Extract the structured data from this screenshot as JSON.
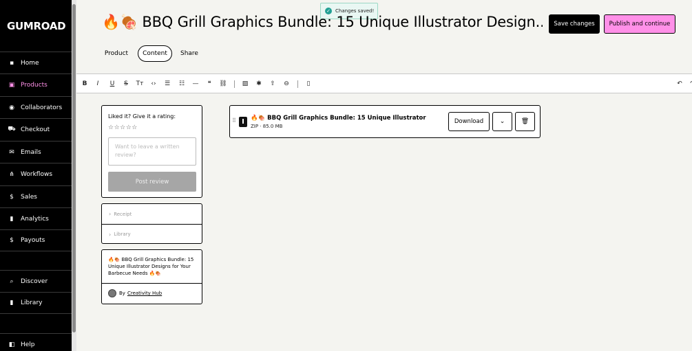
{
  "app": {
    "logo": "GUMROAD"
  },
  "sidebar": {
    "items": [
      {
        "label": "Home",
        "icon": "home-icon",
        "glyph": "▪"
      },
      {
        "label": "Products",
        "icon": "products-icon",
        "glyph": "▣"
      },
      {
        "label": "Collaborators",
        "icon": "collaborators-icon",
        "glyph": "◉"
      },
      {
        "label": "Checkout",
        "icon": "cart-icon",
        "glyph": "⛟"
      },
      {
        "label": "Emails",
        "icon": "mail-icon",
        "glyph": "✉"
      },
      {
        "label": "Workflows",
        "icon": "workflows-icon",
        "glyph": "⋔"
      },
      {
        "label": "Sales",
        "icon": "dollar-icon",
        "glyph": "$"
      },
      {
        "label": "Analytics",
        "icon": "bar-chart-icon",
        "glyph": "▮"
      },
      {
        "label": "Payouts",
        "icon": "bank-icon",
        "glyph": "$"
      },
      {
        "label": "Discover",
        "icon": "search-icon",
        "glyph": "⌕"
      },
      {
        "label": "Library",
        "icon": "bookmark-icon",
        "glyph": "▮"
      },
      {
        "label": "Help",
        "icon": "help-icon",
        "glyph": "◧"
      }
    ],
    "active_index": 1
  },
  "toast": {
    "text": "Changes saved!",
    "glyph": "✓"
  },
  "header": {
    "title": "🔥🍖 BBQ Grill Graphics Bundle: 15 Unique Illustrator Design...",
    "save_label": "Save changes",
    "publish_label": "Publish and continue",
    "tabs": [
      {
        "label": "Product"
      },
      {
        "label": "Content"
      },
      {
        "label": "Share"
      }
    ]
  },
  "toolbar": {
    "tools": [
      {
        "name": "bold-icon",
        "glyph": "B"
      },
      {
        "name": "italic-icon",
        "glyph": "I"
      },
      {
        "name": "underline-icon",
        "glyph": "U"
      },
      {
        "name": "strikethrough-icon",
        "glyph": "S"
      },
      {
        "name": "text-size-icon",
        "glyph": "Tт"
      },
      {
        "name": "code-icon",
        "glyph": "‹›"
      },
      {
        "name": "bullet-list-icon",
        "glyph": "☰"
      },
      {
        "name": "numbered-list-icon",
        "glyph": "☷"
      },
      {
        "name": "horizontal-rule-icon",
        "glyph": "—"
      },
      {
        "name": "quote-icon",
        "glyph": "❝"
      },
      {
        "name": "link-icon",
        "glyph": "⛓"
      },
      {
        "name": "image-icon",
        "glyph": "▨"
      },
      {
        "name": "magic-icon",
        "glyph": "✱"
      },
      {
        "name": "upload-icon",
        "glyph": "⇧"
      },
      {
        "name": "embed-icon",
        "glyph": "⊖"
      },
      {
        "name": "file-icon",
        "glyph": "▯"
      },
      {
        "name": "undo-icon",
        "glyph": "↶"
      },
      {
        "name": "redo-icon",
        "glyph": "↷"
      }
    ]
  },
  "rating": {
    "label": "Liked it? Give it a rating:",
    "stars": "☆☆☆☆☆",
    "placeholder": "Want to leave a written review?",
    "post_label": "Post review"
  },
  "accordion": {
    "items": [
      {
        "label": "Receipt",
        "glyph": "›"
      },
      {
        "label": "Library",
        "glyph": "›"
      }
    ]
  },
  "product_card": {
    "name": "🔥🍖 BBQ Grill Graphics Bundle: 15 Unique Illustrator Designs for Your Barbecue Needs 🔥🍖",
    "by": "By",
    "author": "Creativity Hub"
  },
  "file": {
    "drag_glyph": "⠿",
    "name": "🔥🍖 BBQ Grill Graphics Bundle: 15 Unique Illustrator",
    "meta": "ZIP · 85.0 MB",
    "download_label": "Download",
    "expand_glyph": "⌄",
    "delete_glyph": "🗑"
  }
}
